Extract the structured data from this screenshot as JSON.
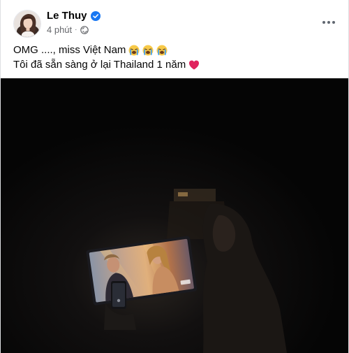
{
  "post": {
    "author": "Le Thuy",
    "verified": true,
    "time": "4 phút",
    "audience_icon": "globe-icon",
    "more_icon": "more-horizontal-icon",
    "text_line1": "OMG ...., miss Việt Nam",
    "text_line2": "Tôi đã sẵn sàng ở lại Thailand 1 năm",
    "line1_emojis": [
      "crying-face-emoji",
      "crying-face-emoji",
      "crying-face-emoji"
    ],
    "line2_emoji": "red-heart-emoji"
  },
  "colors": {
    "name": "#050505",
    "meta": "#65676b",
    "verified": "#1877f2",
    "heart": "#e0245e",
    "media_bg": "#070707"
  },
  "media": {
    "description_icon": "photo-screen-icon"
  }
}
